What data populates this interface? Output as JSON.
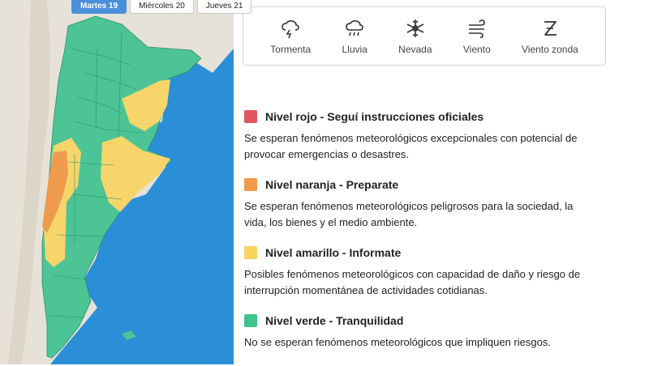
{
  "tabs": [
    {
      "label": "Martes 19",
      "active": true
    },
    {
      "label": "Miércoles 20",
      "active": false
    },
    {
      "label": "Jueves 21",
      "active": false
    }
  ],
  "map": {
    "water_color": "#2a8fd6",
    "land_color": "#e6e2d8",
    "green_color": "#4cc495",
    "yellow_color": "#f7d56b",
    "orange_color": "#f09a4d"
  },
  "phenomena": [
    {
      "icon": "storm-icon",
      "label": "Tormenta"
    },
    {
      "icon": "rain-icon",
      "label": "Lluvia"
    },
    {
      "icon": "snow-icon",
      "label": "Nevada"
    },
    {
      "icon": "wind-icon",
      "label": "Viento"
    },
    {
      "icon": "zonda-wind-icon",
      "label": "Viento zonda"
    }
  ],
  "levels": [
    {
      "color": "#e05761",
      "title": "Nivel rojo - Seguí instrucciones oficiales",
      "desc": "Se esperan fenómenos meteorológicos excepcionales con potencial de provocar emergencias o desastres."
    },
    {
      "color": "#f39a4a",
      "title": "Nivel naranja - Preparate",
      "desc": "Se esperan fenómenos meteorológicos peligrosos para la sociedad, la vida, los bienes y el medio ambiente."
    },
    {
      "color": "#f8d35e",
      "title": "Nivel amarillo - Informate",
      "desc": "Posibles fenómenos meteorológicos con capacidad de daño y riesgo de interrupción momentánea de actividades cotidianas."
    },
    {
      "color": "#3ec58d",
      "title": "Nivel verde - Tranquilidad",
      "desc": "No se esperan fenómenos meteorológicos que impliquen riesgos."
    }
  ]
}
